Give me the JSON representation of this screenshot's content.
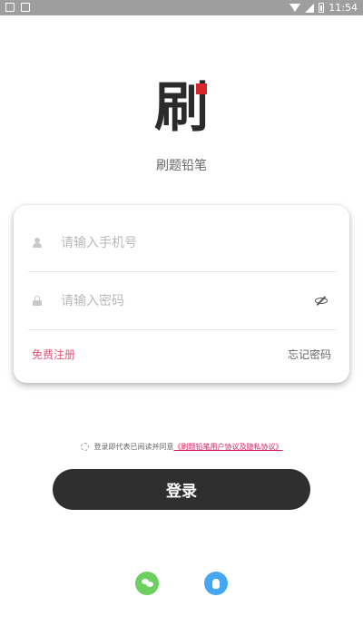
{
  "status_bar": {
    "time": "11:54"
  },
  "logo": {
    "glyph": "刷",
    "accent_color": "#d9262e"
  },
  "app_name": "刷题铅笔",
  "login_form": {
    "phone_placeholder": "请输入手机号",
    "password_placeholder": "请输入密码",
    "register_label": "免费注册",
    "forgot_label": "忘记密码"
  },
  "agreement": {
    "text": "登录即代表已阅读并同意",
    "link": "《刷题铅笔用户协议及隐私协议》"
  },
  "login_button": "登录",
  "social": {
    "wechat_icon": "wechat-icon",
    "qq_icon": "qq-icon",
    "wechat_color": "#6ccf5f",
    "qq_color": "#46a6f2"
  },
  "colors": {
    "link_pink": "#e5527a",
    "button_dark": "#2f2f2f"
  }
}
